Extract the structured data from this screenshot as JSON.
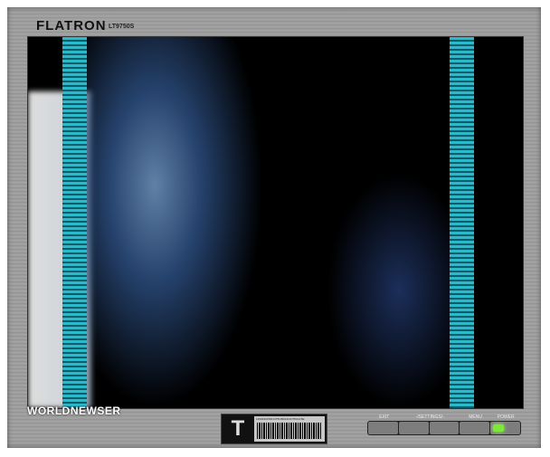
{
  "monitor": {
    "brand": "FLATRON",
    "model": "LT9750S"
  },
  "overlay_label": "WORLDNEWSER",
  "tag": {
    "logo": "T",
    "serial": "1260290156014751090211417501215E"
  },
  "buttons": [
    {
      "label": "EXIT"
    },
    {
      "label": "-/SETTINGS/-"
    },
    {
      "label": ""
    },
    {
      "label": "MENU"
    },
    {
      "label": "POWER"
    }
  ],
  "colors": {
    "stripe": "#2bb9cc",
    "power_led": "#7ee83a"
  }
}
